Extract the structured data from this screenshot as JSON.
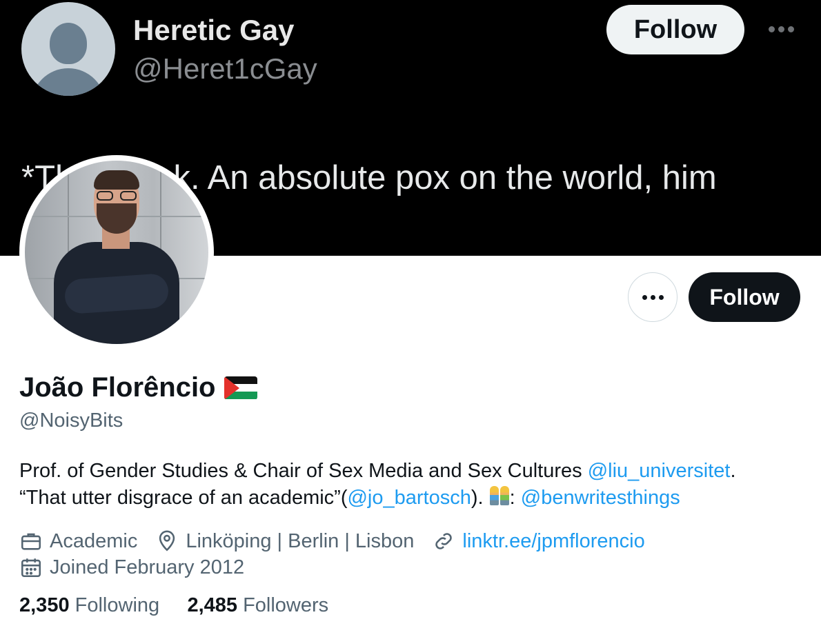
{
  "banner": {
    "name": "Heretic Gay",
    "handle": "@Heret1cGay",
    "follow_label": "Follow",
    "text": "*Th        ick. An absolute pox on the world, him                        hetic boyfriend."
  },
  "profile": {
    "name": "João Florêncio",
    "handle": "@NoisyBits",
    "follow_label": "Follow",
    "bio": {
      "part1": "Prof. of Gender Studies & Chair of Sex Media and Sex Cultures ",
      "link1": "@liu_universitet",
      "part2": ".",
      "part3": "“That utter disgrace of an academic”(",
      "link2": "@jo_bartosch",
      "part4": "). ",
      "part5": ": ",
      "link3": "@benwritesthings"
    },
    "category": "Academic",
    "location": "Linköping | Berlin | Lisbon",
    "website": "linktr.ee/jpmflorencio",
    "joined": "Joined February 2012",
    "following_count": "2,350",
    "following_label": "Following",
    "followers_count": "2,485",
    "followers_label": "Followers"
  },
  "icons": {
    "banner_more": "more-horizontal-icon",
    "more": "more-horizontal-icon",
    "flag": "palestine-flag-icon",
    "couple": "two-men-holding-hands-icon",
    "category": "briefcase-icon",
    "location": "location-pin-icon",
    "website": "link-icon",
    "joined": "calendar-icon"
  },
  "colors": {
    "link": "#1d9bf0",
    "secondary_text": "#536471",
    "follow_button_bg": "#0f1419",
    "banner_bg": "#000000"
  }
}
